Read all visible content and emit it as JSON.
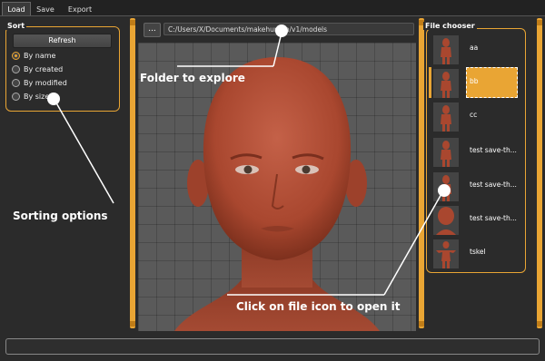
{
  "tabs": [
    {
      "label": "Load",
      "active": true
    },
    {
      "label": "Save",
      "active": false
    },
    {
      "label": "Export",
      "active": false
    }
  ],
  "sort": {
    "title": "Sort",
    "refresh_label": "Refresh",
    "options": [
      {
        "label": "By name",
        "selected": true
      },
      {
        "label": "By created",
        "selected": false
      },
      {
        "label": "By modified",
        "selected": false
      },
      {
        "label": "By size",
        "selected": false
      }
    ]
  },
  "path": {
    "browse_label": "...",
    "value": "C:/Users/X/Documents/makehuman/v1/models"
  },
  "file_chooser": {
    "title": "File chooser",
    "files": [
      {
        "name": "aa",
        "selected": false
      },
      {
        "name": "bb",
        "selected": true
      },
      {
        "name": "cc",
        "selected": false
      },
      {
        "name": "test save-th...",
        "selected": false
      },
      {
        "name": "test save-th...",
        "selected": false
      },
      {
        "name": "test save-th...",
        "selected": false
      },
      {
        "name": "tskel",
        "selected": false
      }
    ]
  },
  "annotations": {
    "folder": "Folder to explore",
    "sorting": "Sorting options",
    "open": "Click on file icon to open it"
  },
  "colors": {
    "accent": "#e9a534",
    "skin": "#b24e35",
    "background": "#2b2b2b"
  }
}
